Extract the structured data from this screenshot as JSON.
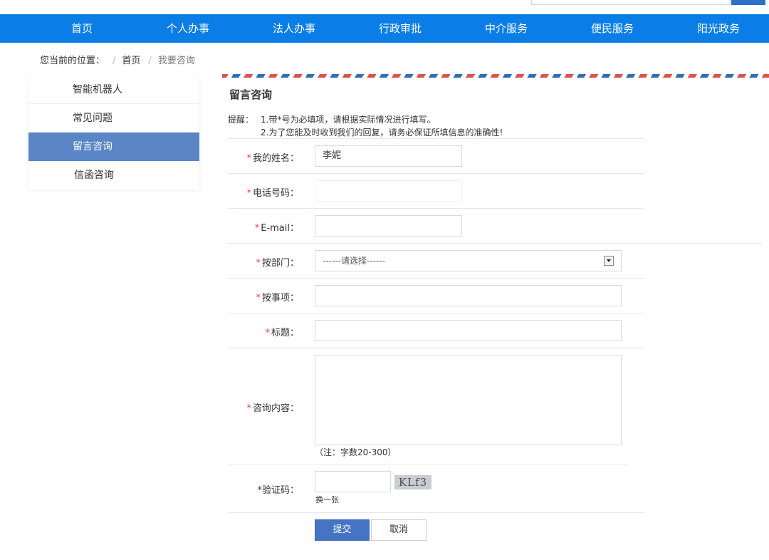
{
  "nav": {
    "items": [
      "首页",
      "个人办事",
      "法人办事",
      "行政审批",
      "中介服务",
      "便民服务",
      "阳光政务"
    ]
  },
  "breadcrumb": {
    "prefix": "您当前的位置：",
    "home": "首页",
    "current": "我要咨询"
  },
  "sidebar": {
    "items": [
      {
        "label": "智能机器人"
      },
      {
        "label": "常见问题"
      },
      {
        "label": "留言咨询"
      },
      {
        "label": "信函咨询"
      }
    ]
  },
  "form": {
    "title": "留言咨询",
    "notice_label": "提醒：",
    "notice_lines": [
      "1.带*号为必填项，请根据实际情况进行填写。",
      "2.为了您能及时收到我们的回复，请务必保证所填信息的准确性!"
    ],
    "fields": {
      "name": {
        "label": "我的姓名：",
        "value": "李妮"
      },
      "phone": {
        "label": "电话号码：",
        "value": ""
      },
      "email": {
        "label": "E-mail：",
        "value": ""
      },
      "department": {
        "label": "按部门：",
        "value": "------请选择------"
      },
      "matter": {
        "label": "按事项：",
        "value": ""
      },
      "subject": {
        "label": "标题：",
        "value": ""
      },
      "content": {
        "label": "咨询内容：",
        "value": "",
        "note": "（注：字数20-300）"
      },
      "captcha": {
        "label": "验证码：",
        "value": "",
        "image_text": "KLf3",
        "refresh": "换一张"
      }
    },
    "required_mark": "*",
    "submit_label": "提交",
    "cancel_label": "取消"
  },
  "colors": {
    "nav_bg": "#0a7ee6",
    "sidebar_active": "#5a86c6",
    "submit_bg": "#4574c4",
    "required": "#e04a3a"
  }
}
